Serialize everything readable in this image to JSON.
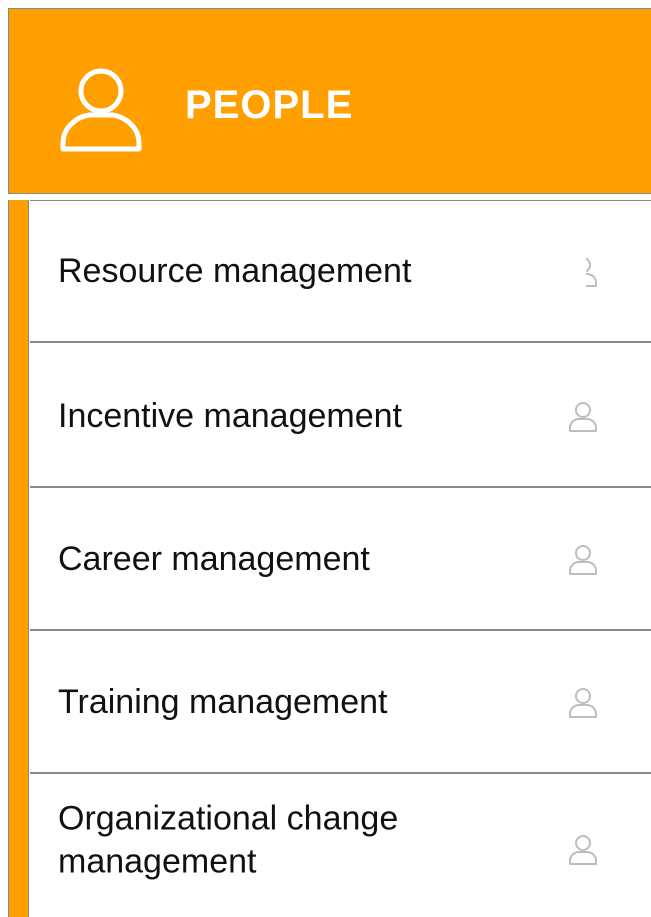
{
  "header": {
    "title": "PEOPLE",
    "icon": "person-outline-icon",
    "background_color": "#FF9F00"
  },
  "items": [
    {
      "label": "Resource management",
      "icon": "person-outline-icon"
    },
    {
      "label": "Incentive management",
      "icon": "person-outline-icon"
    },
    {
      "label": "Career management",
      "icon": "person-outline-icon"
    },
    {
      "label": "Training management",
      "icon": "person-outline-icon"
    },
    {
      "label": "Organizational change\n management",
      "icon": "person-outline-icon"
    }
  ],
  "colors": {
    "accent": "#FF9F00",
    "text": "#111111",
    "icon": "#bdbdbd",
    "divider": "#8a8a8a"
  }
}
